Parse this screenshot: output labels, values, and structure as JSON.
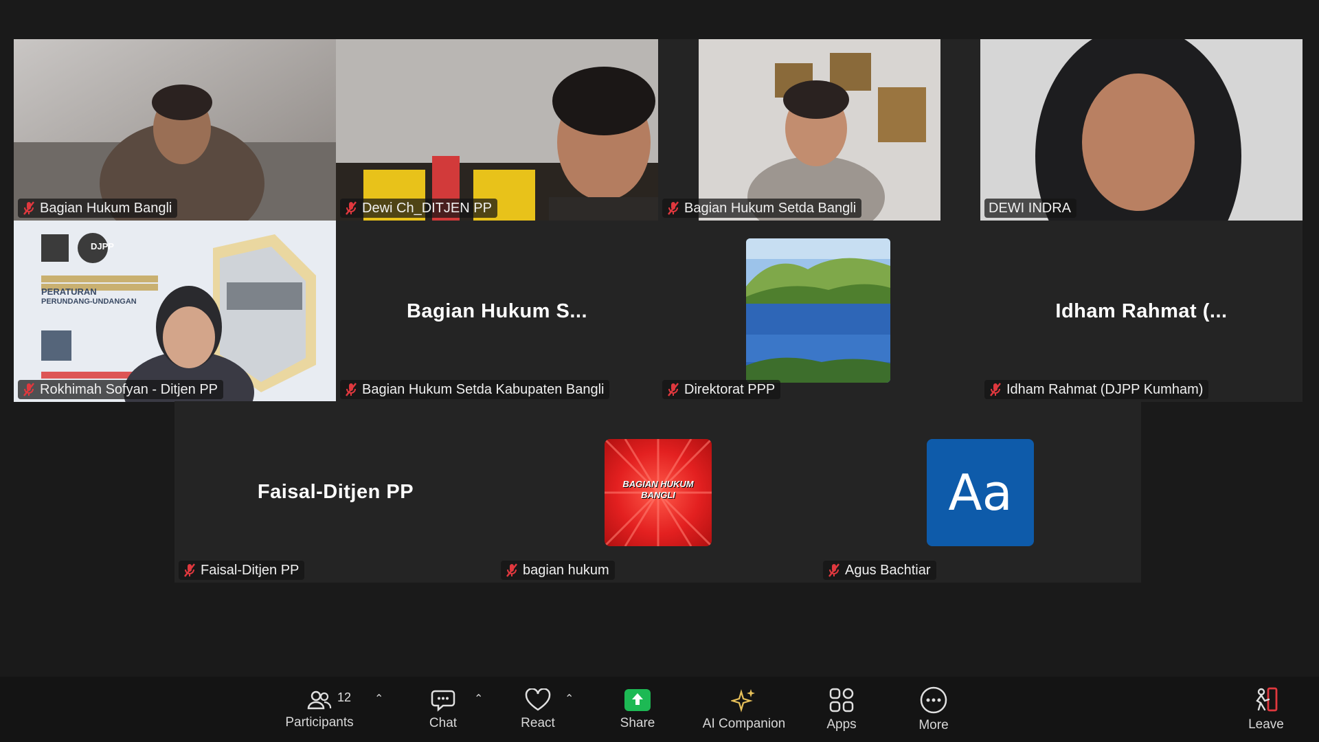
{
  "tiles": [
    {
      "id": "t1",
      "name": "Bagian Hukum Bangli",
      "muted": true
    },
    {
      "id": "t2",
      "name": "Dewi Ch_DITJEN PP",
      "muted": true
    },
    {
      "id": "t3",
      "name": "Bagian Hukum Setda Bangli",
      "muted": true
    },
    {
      "id": "t4",
      "name": "DEWI INDRA",
      "muted": false,
      "active": true
    },
    {
      "id": "t5",
      "name": "Rokhimah Sofyan - Ditjen PP",
      "muted": true
    },
    {
      "id": "t6",
      "name": "Bagian Hukum Setda Kabupaten Bangli",
      "display": "Bagian Hukum S...",
      "muted": true
    },
    {
      "id": "t7",
      "name": "Direktorat PPP",
      "muted": true
    },
    {
      "id": "t8",
      "name": "Idham Rahmat (DJPP Kumham)",
      "display": "Idham Rahmat (...",
      "muted": true
    },
    {
      "id": "t9",
      "name": "Faisal-Ditjen PP",
      "display": "Faisal-Ditjen PP",
      "muted": true
    },
    {
      "id": "t10",
      "name": "bagian hukum",
      "avatar_text": "BAGIAN HUKUM BANGLI",
      "muted": true
    },
    {
      "id": "t11",
      "name": "Agus Bachtiar",
      "avatar_text": "Aa",
      "muted": true
    }
  ],
  "slide": {
    "logo_text": "DJPP",
    "line1": "PERATURAN",
    "line2": "PERUNDANG-UNDANGAN"
  },
  "toolbar": {
    "participants": {
      "label": "Participants",
      "count": "12"
    },
    "chat": {
      "label": "Chat"
    },
    "react": {
      "label": "React"
    },
    "share": {
      "label": "Share"
    },
    "ai": {
      "label": "AI Companion"
    },
    "apps": {
      "label": "Apps"
    },
    "more": {
      "label": "More"
    },
    "leave": {
      "label": "Leave"
    }
  },
  "colors": {
    "active_border": "#23d96b",
    "share_green": "#1db954",
    "mic_red": "#e0383e",
    "leave_red": "#e0383e",
    "avatar_blue": "#0e5baa",
    "avatar_red": "#e32020"
  }
}
